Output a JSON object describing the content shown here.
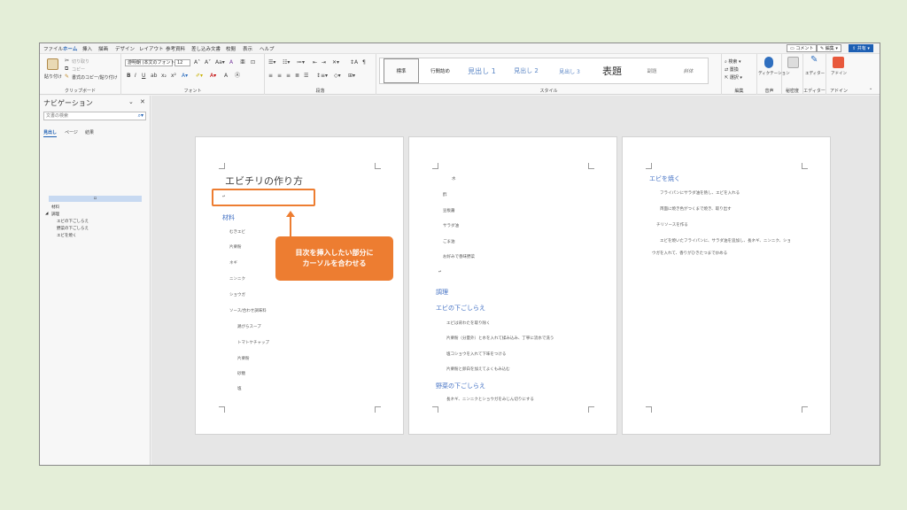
{
  "menu": {
    "tabs": [
      "ファイル",
      "ホーム",
      "挿入",
      "描画",
      "デザイン",
      "レイアウト",
      "参考資料",
      "差し込み文書",
      "校閲",
      "表示",
      "ヘルプ"
    ],
    "active_tab": "ホーム",
    "comment_label": "コメント",
    "edit_label": "編集",
    "share_label": "共有"
  },
  "ribbon": {
    "clipboard": {
      "paste": "貼り付け",
      "cut": "切り取り",
      "copy": "コピー",
      "format_painter": "書式のコピー/貼り付け",
      "label": "クリップボード"
    },
    "font": {
      "name": "游明朝 (本文のフォント",
      "size": "12",
      "label": "フォント"
    },
    "paragraph": {
      "label": "段落"
    },
    "styles": {
      "items": [
        "標準",
        "行間詰め",
        "見出し 1",
        "見出し 2",
        "見出し 3",
        "表題",
        "副題",
        "斜体"
      ],
      "label": "スタイル"
    },
    "editing": {
      "find": "検索",
      "replace": "置換",
      "select": "選択",
      "label": "編集"
    },
    "voice": {
      "dictate": "ディクテーション",
      "label": "音声"
    },
    "sensitivity": {
      "label": "秘密度"
    },
    "editor": {
      "name": "エディター",
      "label": "エディター"
    },
    "addins": {
      "name": "アドイン",
      "label": "アドイン"
    }
  },
  "nav": {
    "title": "ナビゲーション",
    "search_placeholder": "文書の検索",
    "tabs": [
      "見出し",
      "ページ",
      "結果"
    ],
    "selected_item": "",
    "items": [
      "材料",
      "調理",
      "エビの下ごしらえ",
      "野菜の下ごしらえ",
      "エビを焼く"
    ]
  },
  "page1": {
    "title": "エビチリの作り方",
    "heading": "材料",
    "lines": [
      "むきエビ",
      "片栗粉",
      "ネギ",
      "ニンニク",
      "ショウガ",
      "ソース/合わせ調味料",
      "鶏がらスープ",
      "トマトケチャップ",
      "片栗粉",
      "砂糖",
      "塩"
    ]
  },
  "page2": {
    "lines": [
      "水",
      "酢",
      "豆板醤",
      "サラダ油",
      "ごま油",
      "お好みで香味野菜"
    ],
    "h_cook": "調理",
    "h_shrimp": "エビの下ごしらえ",
    "shrimp_lines": [
      "エビは背わたを取り除く",
      "片栗粉（分量外）と水を入れて揉み込み、丁寧に流水で洗う",
      "塩コショウを入れて下味をつける",
      "片栗粉と卵白を加えてよくもみ込む"
    ],
    "h_veg": "野菜の下ごしらえ",
    "veg_lines": [
      "長ネギ、ニンニクとショウガをみじん切りにする"
    ]
  },
  "page3": {
    "heading": "エビを焼く",
    "lines": [
      "フライパンにサラダ油を熱し、エビを入れる",
      "両面に焼き色がつくまで焼き、取り出す",
      "チリソースを作る",
      "エビを焼いたフライパンに、サラダ油を追加し、長ネギ、ニンニク、ショ",
      "ウガを入れて、香りがひきたつまで炒める"
    ]
  },
  "callout": {
    "line1": "目次を挿入したい部分に",
    "line2": "カーソルを合わせる"
  },
  "colors": {
    "accent": "#ed7d31",
    "heading": "#4472c4",
    "brand": "#1d5fb3",
    "background": "#e4eed8"
  }
}
